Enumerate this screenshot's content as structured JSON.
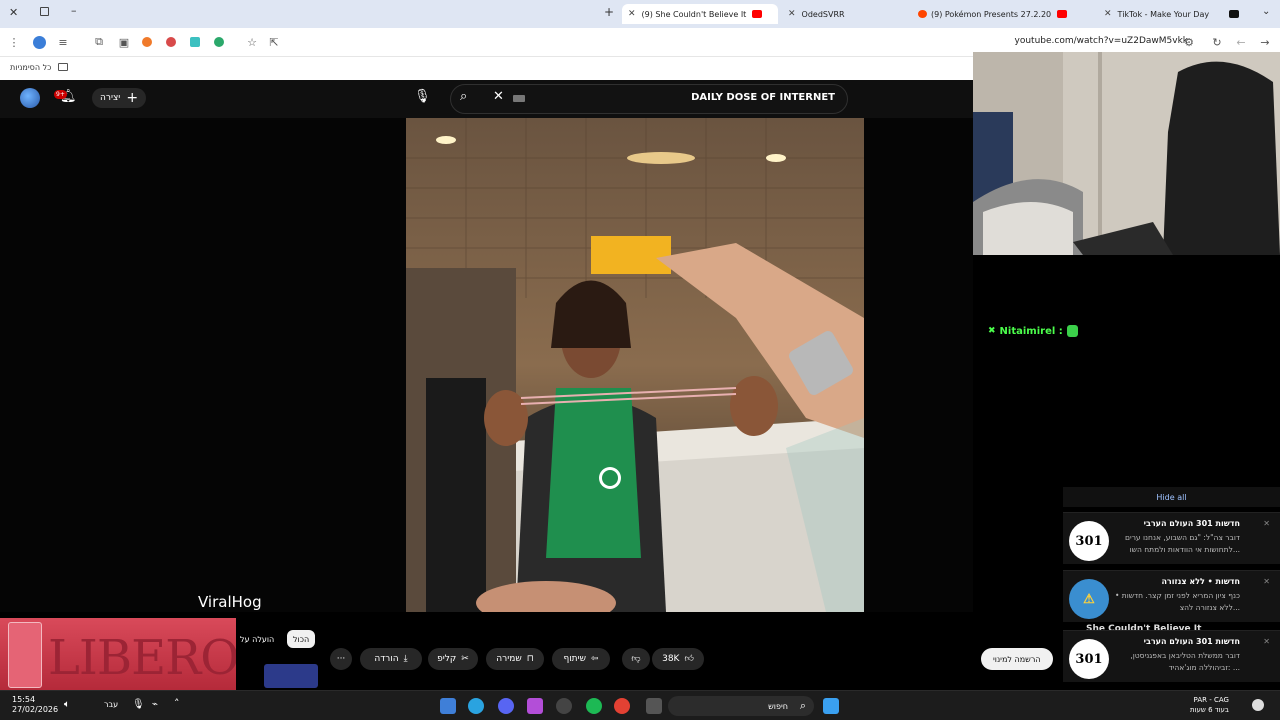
{
  "browser": {
    "tabs": [
      {
        "label": "(9) She Couldn't Believe It",
        "active": true
      },
      {
        "label": "OdedSVRR",
        "active": false
      },
      {
        "label": "(9) Pokémon Presents 27.2.2026",
        "active": false
      },
      {
        "label": "TikTok - Make Your Day",
        "active": false
      }
    ],
    "url": "youtube.com/watch?v=uZ2DawM5vkk",
    "bookmarks_label": "כל הסימניות"
  },
  "youtube": {
    "notification_count": "9+",
    "create_label": "יצירה",
    "search_query": "DAILY DOSE OF INTERNET",
    "watermark": "ViralHog",
    "actions": {
      "likes": "38K",
      "share": "שיתוף",
      "save": "שמירה",
      "clip": "קליפ",
      "download": "הורדה",
      "more": "···"
    },
    "chips": {
      "all": "הכול",
      "uploaded_by": "הועלה על"
    },
    "subscribe_label": "הרשמה למינוי"
  },
  "overlay": {
    "chat_user": "Nitaimirel :",
    "ad_brand": "LIBERO",
    "hide_all": "Hide all",
    "behind_text": "She Couldn't Believe It",
    "notifications": [
      {
        "title": "חדשות 301 העולם הערבי",
        "body": "דובר צה\"ל: \"גם השבוע, אנחנו ערים לתחושות אי הוודאות ולמתח השו...",
        "logo": "301"
      },
      {
        "title": "חדשות • ללא צנזורה",
        "body": "כנף ציון המריא לפני זמן קצר. חדשות • ללא צנזורה להצ...",
        "logo": "⚠"
      },
      {
        "title": "חדשות 301 העולם הערבי",
        "body": "דובר ממשלת הטליבאן באפגניסטן, זביהוללה מוג'אהיד: ...",
        "logo": "301"
      }
    ]
  },
  "taskbar": {
    "time": "15:54",
    "date": "27/02/2026",
    "lang": "עבר",
    "search_placeholder": "חיפוש",
    "weather_line1": "PAR - CAG",
    "weather_line2": "בעוד 6 שעות"
  },
  "colors": {
    "accent_red": "#cc0000",
    "chat_green": "#4cff4c",
    "link_blue": "#9ec2ff"
  }
}
